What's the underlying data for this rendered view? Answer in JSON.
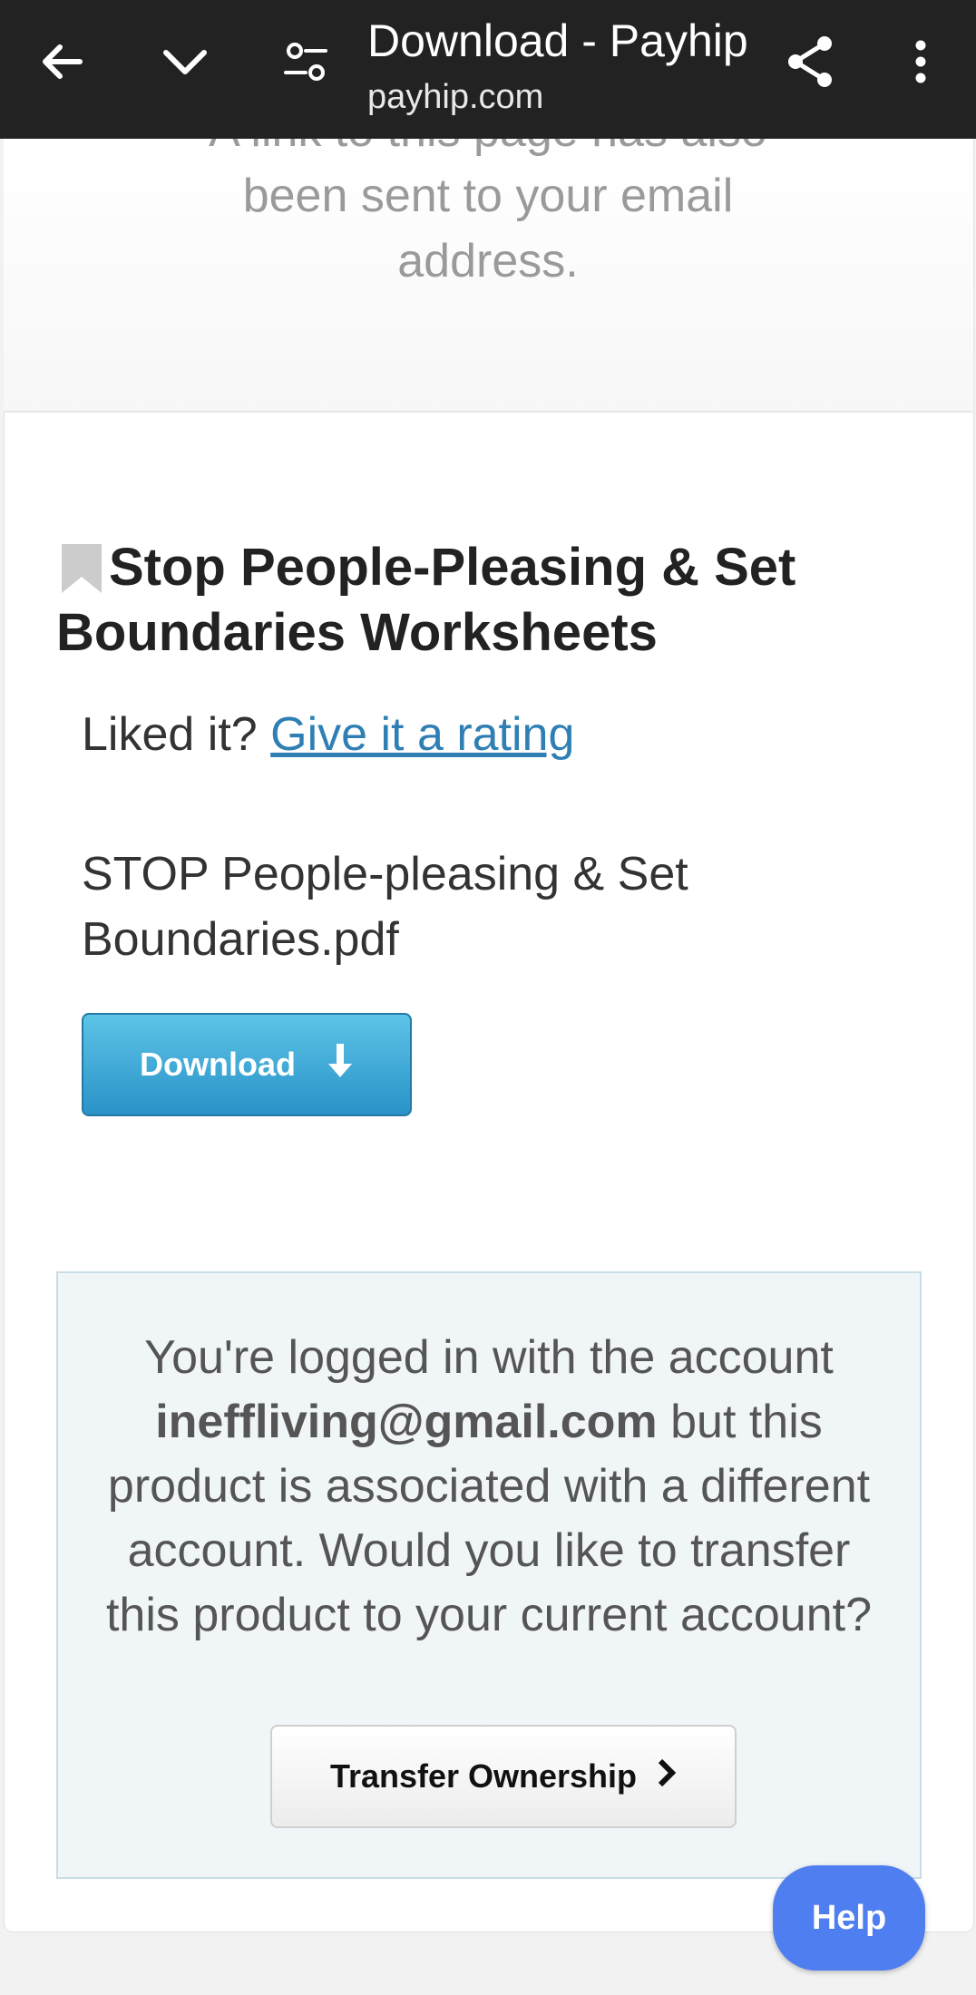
{
  "browser": {
    "title": "Download - Payhip",
    "url": "payhip.com",
    "icons": [
      "back-arrow-icon",
      "chevron-down-icon",
      "page-settings-icon",
      "share-icon",
      "more-vert-icon"
    ]
  },
  "notice": {
    "line1": "A link to this page has also",
    "line2": "been sent to your email",
    "line3": "address."
  },
  "product": {
    "title": "Stop People-Pleasing & Set Boundaries Worksheets",
    "rating_prompt": "Liked it?",
    "rating_link": "Give it a rating",
    "filename": "STOP People-pleasing & Set Boundaries.pdf",
    "download_label": "Download"
  },
  "transfer": {
    "text_before": "You're logged in with the account",
    "email": "ineffliving@gmail.com",
    "text_after": "but this product is associated with a different account. Would you like to transfer this product to your current account?",
    "button_label": "Transfer Ownership"
  },
  "help": {
    "label": "Help"
  },
  "colors": {
    "topbar": "#222222",
    "download_button": "#2a92c8",
    "link": "#2f7fb5",
    "help_button": "#4f7ef0",
    "transfer_box": "#f0f5f8"
  }
}
